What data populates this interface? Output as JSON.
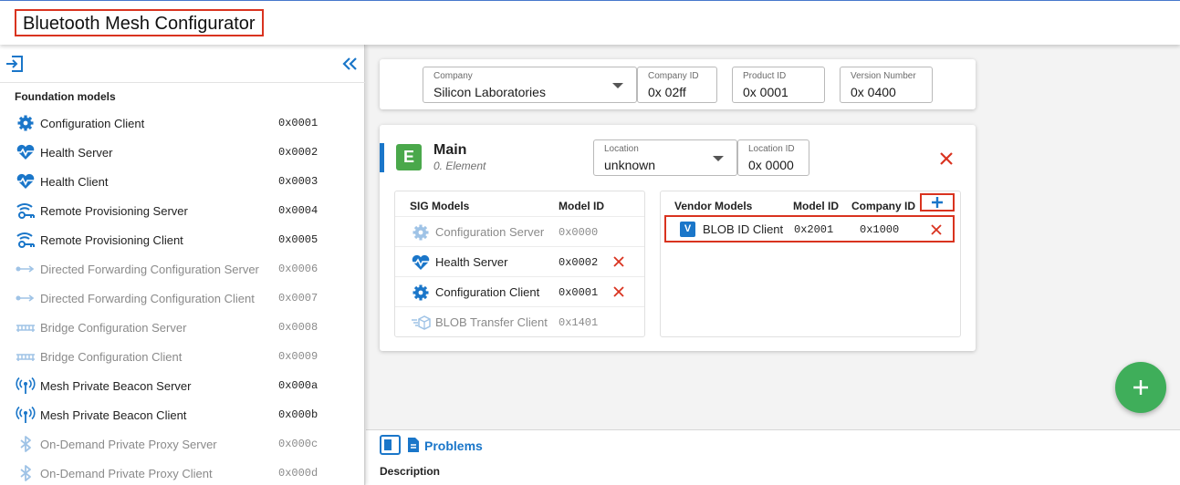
{
  "app": {
    "title": "Bluetooth Mesh Configurator"
  },
  "colors": {
    "accent": "#1a76c9",
    "danger": "#d9331f",
    "element_badge": "#4aa84b",
    "fab": "#3fae5a",
    "disabled": "#8a8a8a"
  },
  "sidebar": {
    "heading": "Foundation models",
    "import_icon": "import-icon",
    "collapse_icon": "double-chevron-left-icon",
    "items": [
      {
        "label": "Configuration Client",
        "id": "0x0001",
        "icon": "gear-icon",
        "enabled": true
      },
      {
        "label": "Health Server",
        "id": "0x0002",
        "icon": "heartbeat-icon",
        "enabled": true
      },
      {
        "label": "Health Client",
        "id": "0x0003",
        "icon": "heartbeat-icon",
        "enabled": true
      },
      {
        "label": "Remote Provisioning Server",
        "id": "0x0004",
        "icon": "wifi-key-icon",
        "enabled": true
      },
      {
        "label": "Remote Provisioning Client",
        "id": "0x0005",
        "icon": "wifi-key-icon",
        "enabled": true
      },
      {
        "label": "Directed Forwarding Configuration Server",
        "id": "0x0006",
        "icon": "forward-arrow-icon",
        "enabled": false
      },
      {
        "label": "Directed Forwarding Configuration Client",
        "id": "0x0007",
        "icon": "forward-arrow-icon",
        "enabled": false
      },
      {
        "label": "Bridge Configuration Server",
        "id": "0x0008",
        "icon": "bridge-icon",
        "enabled": false
      },
      {
        "label": "Bridge Configuration Client",
        "id": "0x0009",
        "icon": "bridge-icon",
        "enabled": false
      },
      {
        "label": "Mesh Private Beacon Server",
        "id": "0x000a",
        "icon": "beacon-icon",
        "enabled": true
      },
      {
        "label": "Mesh Private Beacon Client",
        "id": "0x000b",
        "icon": "beacon-icon",
        "enabled": true
      },
      {
        "label": "On-Demand Private Proxy Server",
        "id": "0x000c",
        "icon": "bluetooth-icon",
        "enabled": false
      },
      {
        "label": "On-Demand Private Proxy Client",
        "id": "0x000d",
        "icon": "bluetooth-icon",
        "enabled": false
      }
    ]
  },
  "company_card": {
    "company": {
      "label": "Company",
      "value": "Silicon Laboratories"
    },
    "company_id": {
      "label": "Company ID",
      "value": "0x 02ff"
    },
    "product_id": {
      "label": "Product ID",
      "value": "0x 0001"
    },
    "version_number": {
      "label": "Version Number",
      "value": "0x 0400"
    }
  },
  "element": {
    "badge": "E",
    "name": "Main",
    "subtitle": "0. Element",
    "location": {
      "label": "Location",
      "value": "unknown"
    },
    "location_id": {
      "label": "Location ID",
      "value": "0x 0000"
    },
    "sig_models": {
      "header": "SIG Models",
      "id_header": "Model ID",
      "rows": [
        {
          "label": "Configuration Server",
          "id": "0x0000",
          "icon": "gear-icon",
          "enabled": false,
          "deletable": false
        },
        {
          "label": "Health Server",
          "id": "0x0002",
          "icon": "heartbeat-icon",
          "enabled": true,
          "deletable": true
        },
        {
          "label": "Configuration Client",
          "id": "0x0001",
          "icon": "gear-icon",
          "enabled": true,
          "deletable": true
        },
        {
          "label": "BLOB Transfer Client",
          "id": "0x1401",
          "icon": "blob-transfer-icon",
          "enabled": false,
          "deletable": false
        }
      ]
    },
    "vendor_models": {
      "header": "Vendor Models",
      "id_header": "Model ID",
      "company_header": "Company ID",
      "rows": [
        {
          "badge": "V",
          "label": "BLOB ID Client",
          "id": "0x2001",
          "company_id": "0x1000"
        }
      ]
    }
  },
  "bottom_panel": {
    "title": "Problems",
    "description_label": "Description"
  }
}
